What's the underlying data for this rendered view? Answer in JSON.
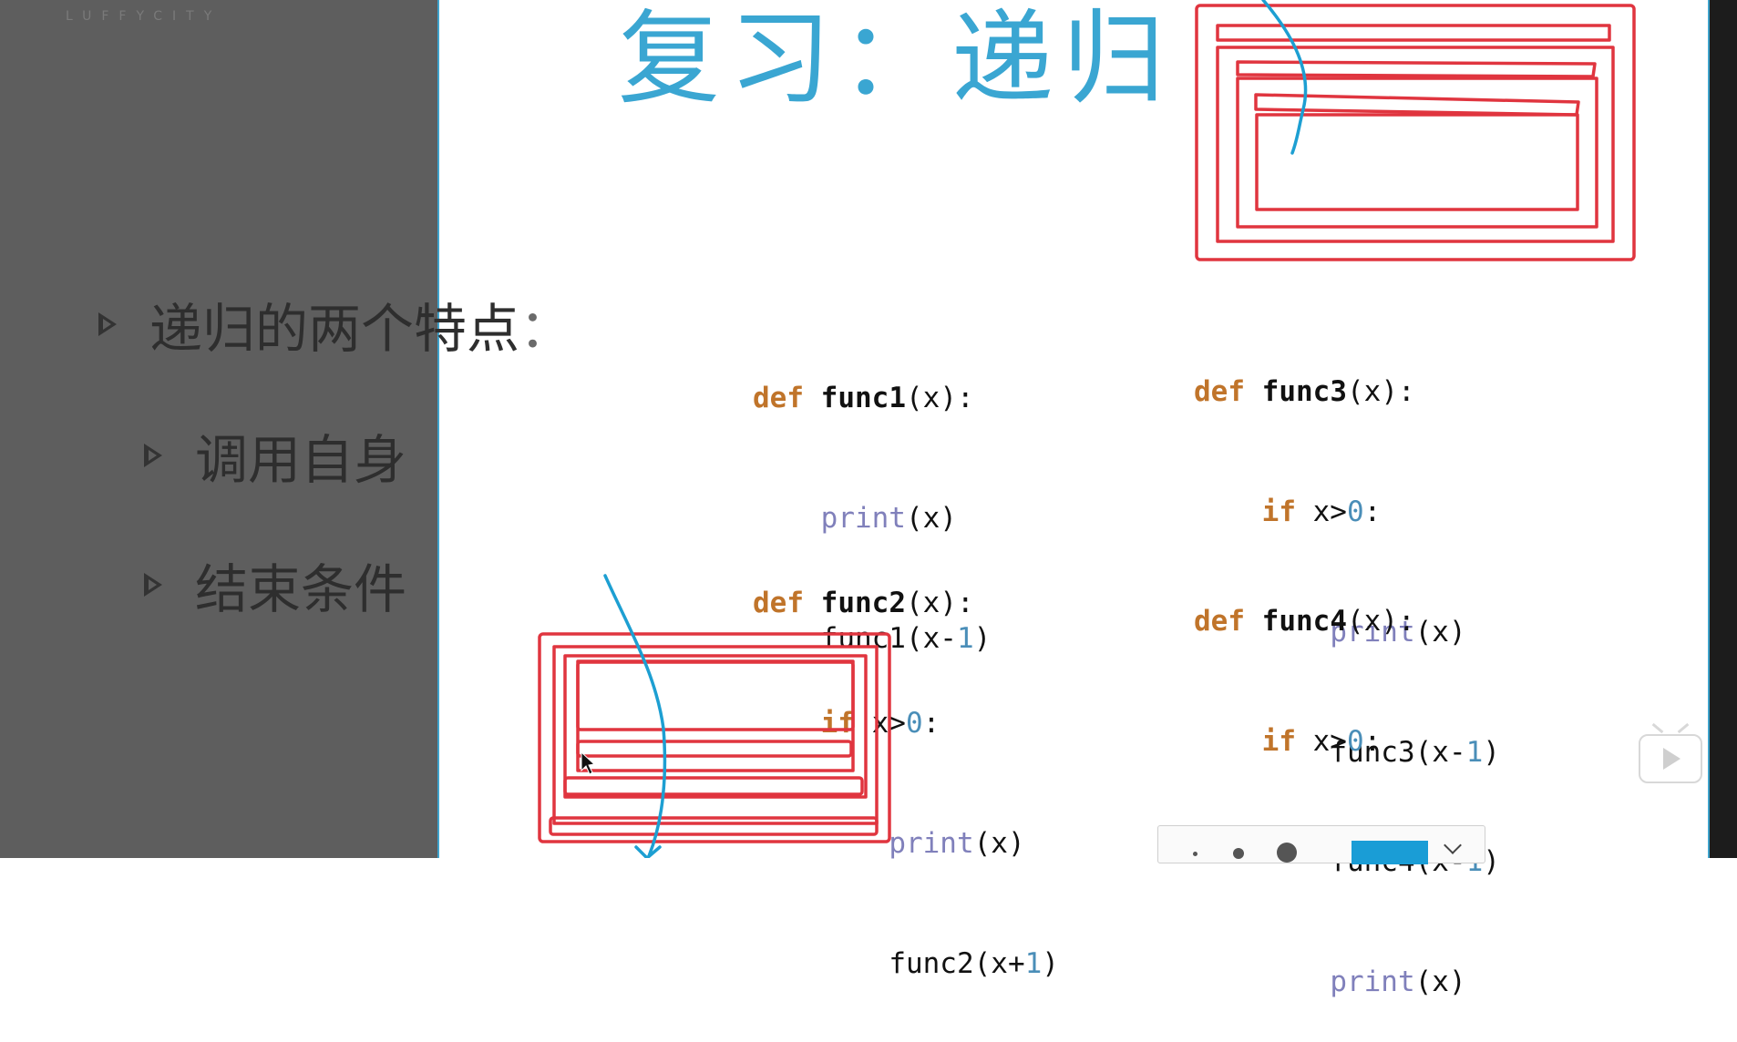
{
  "slide": {
    "logo_sub": "LUFFYCITY",
    "title": "复习：递归",
    "bullets": [
      {
        "dark": "递归的两个特点",
        "light": "："
      },
      {
        "text": "调用自身"
      },
      {
        "text": "结束条件"
      }
    ]
  },
  "code": {
    "func1": {
      "def": "def",
      "name": "func1",
      "params": "(x):",
      "print_kw": "print",
      "print_args": "(x)",
      "call_pre": "func1(x-",
      "call_num": "1",
      "call_post": ")"
    },
    "func2": {
      "def": "def",
      "name": "func2",
      "params": "(x):",
      "if_kw": "if",
      "cond_pre": " x>",
      "cond_num": "0",
      "cond_post": ":",
      "print_kw": "print",
      "print_args": "(x)",
      "call_pre": "func2(x+",
      "call_num": "1",
      "call_post": ")"
    },
    "func3": {
      "def": "def",
      "name": "func3",
      "params": "(x):",
      "if_kw": "if",
      "cond_pre": " x>",
      "cond_num": "0",
      "cond_post": ":",
      "print_kw": "print",
      "print_args": "(x)",
      "call_pre": "func3(x-",
      "call_num": "1",
      "call_post": ")"
    },
    "func4": {
      "def": "def",
      "name": "func4",
      "params": "(x):",
      "if_kw": "if",
      "cond_pre": " x>",
      "cond_num": "0",
      "cond_post": ":",
      "call_pre": "func4(x-",
      "call_num": "1",
      "call_post": ")",
      "print_kw": "print",
      "print_args": "(x)"
    }
  },
  "annotation": {
    "box_color": "#e0353f",
    "arrow_color": "#1d9fd2"
  },
  "player": {
    "play_icon": "play-icon",
    "pen_colors": [
      "#1a9dd6"
    ]
  }
}
